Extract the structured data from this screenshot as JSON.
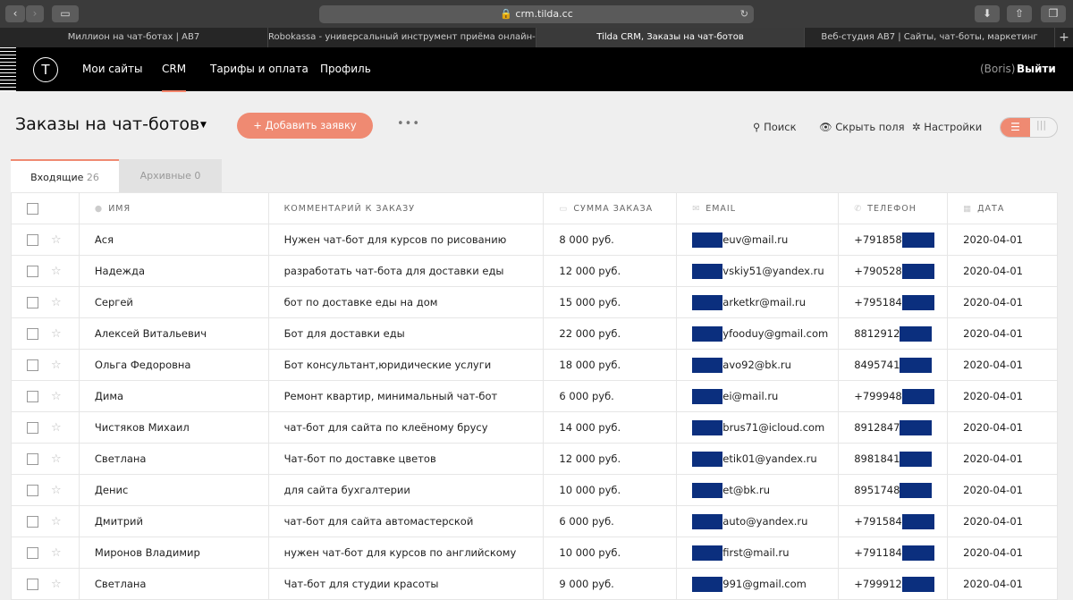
{
  "browser": {
    "url": "crm.tilda.cc",
    "tabs": [
      "Миллион на чат-ботах | AB7",
      "Robokassa - универсальный инструмент приёма онлайн-пл...",
      "Tilda CRM, Заказы на чат-ботов",
      "Веб-студия AB7 | Сайты, чат-боты, маркетинг"
    ],
    "new_tab": "+"
  },
  "nav": {
    "logo": "T",
    "items": [
      "Мои сайты",
      "CRM",
      "Тарифы и оплата",
      "Профиль"
    ],
    "user": "(Boris)",
    "logout": "Выйти"
  },
  "page": {
    "title": "Заказы на чат-ботов",
    "add_label": "+ Добавить заявку",
    "more": "•••",
    "search": "Поиск",
    "hide_fields": "Скрыть поля",
    "settings": "Настройки"
  },
  "tabs": [
    {
      "label": "Входящие",
      "count": "26"
    },
    {
      "label": "Архивные",
      "count": "0"
    }
  ],
  "columns": [
    "ИМЯ",
    "КОММЕНТАРИЙ К ЗАКАЗУ",
    "СУММА ЗАКАЗА",
    "EMAIL",
    "ТЕЛЕФОН",
    "ДАТА"
  ],
  "rows": [
    [
      "Ася",
      "Нужен чат-бот для курсов по рисованию",
      "8 000 руб.",
      "euv@mail.ru",
      "+791858",
      "2020-04-01"
    ],
    [
      "Надежда",
      "разработать чат-бота для доставки еды",
      "12 000 руб.",
      "vskiy51@yandex.ru",
      "+790528",
      "2020-04-01"
    ],
    [
      "Сергей",
      "бот по доставке еды на дом",
      "15 000 руб.",
      "arketkr@mail.ru",
      "+795184",
      "2020-04-01"
    ],
    [
      "Алексей Витальевич",
      "Бот для доставки еды",
      "22 000 руб.",
      "yfooduy@gmail.com",
      "8812912",
      "2020-04-01"
    ],
    [
      "Ольга Федоровна",
      "Бот консультант,юридические услуги",
      "18 000 руб.",
      "avo92@bk.ru",
      "8495741",
      "2020-04-01"
    ],
    [
      "Дима",
      "Ремонт квартир, минимальный чат-бот",
      "6 000 руб.",
      "ei@mail.ru",
      "+799948",
      "2020-04-01"
    ],
    [
      "Чистяков Михаил",
      "чат-бот для сайта по клеёному брусу",
      "14 000 руб.",
      "brus71@icloud.com",
      "8912847",
      "2020-04-01"
    ],
    [
      "Светлана",
      "Чат-бот по доставке цветов",
      "12 000 руб.",
      "etik01@yandex.ru",
      "8981841",
      "2020-04-01"
    ],
    [
      "Денис",
      "для сайта бухгалтерии",
      "10 000 руб.",
      "et@bk.ru",
      "8951748",
      "2020-04-01"
    ],
    [
      "Дмитрий",
      "чат-бот для сайта автомастерской",
      "6 000 руб.",
      "auto@yandex.ru",
      "+791584",
      "2020-04-01"
    ],
    [
      "Миронов Владимир",
      "нужен чат-бот для курсов по английскому",
      "10 000 руб.",
      "first@mail.ru",
      "+791184",
      "2020-04-01"
    ],
    [
      "Светлана",
      "Чат-бот для студии красоты",
      "9 000 руб.",
      "991@gmail.com",
      "+799912",
      "2020-04-01"
    ]
  ]
}
